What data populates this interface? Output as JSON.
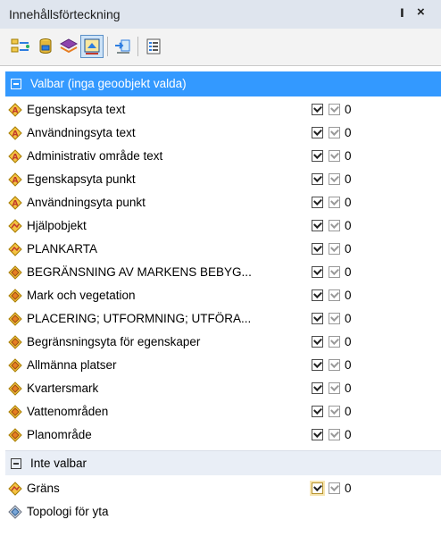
{
  "window": {
    "title": "Innehållsförteckning",
    "pin_glyph": "ⵏ",
    "close_glyph": "×"
  },
  "toolbar": {
    "buttons": [
      {
        "name": "list-by-drawing-order-icon"
      },
      {
        "name": "list-by-source-icon"
      },
      {
        "name": "list-by-visibility-icon"
      },
      {
        "name": "list-by-selection-icon",
        "active": true
      },
      {
        "name": "options-icon"
      },
      {
        "name": "list-options-icon"
      }
    ]
  },
  "groups": [
    {
      "label": "Valbar (inga geoobjekt valda)",
      "selected": true,
      "items": [
        {
          "label": "Egenskapsyta text",
          "icon": "annotation-icon",
          "count": "0"
        },
        {
          "label": "Användningsyta text",
          "icon": "annotation-icon",
          "count": "0"
        },
        {
          "label": "Administrativ område text",
          "icon": "annotation-icon",
          "count": "0"
        },
        {
          "label": "Egenskapsyta punkt",
          "icon": "annotation-icon",
          "count": "0"
        },
        {
          "label": "Användningsyta punkt",
          "icon": "annotation-icon",
          "count": "0"
        },
        {
          "label": "Hjälpobjekt",
          "icon": "line-layer-icon",
          "count": "0"
        },
        {
          "label": "PLANKARTA",
          "icon": "line-layer-icon",
          "count": "0"
        },
        {
          "label": "BEGRÄNSNING AV MARKENS BEBYG...",
          "icon": "polygon-layer-icon",
          "count": "0"
        },
        {
          "label": "Mark och vegetation",
          "icon": "polygon-layer-icon",
          "count": "0"
        },
        {
          "label": "PLACERING; UTFORMNING; UTFÖRA...",
          "icon": "polygon-layer-icon",
          "count": "0"
        },
        {
          "label": "Begränsningsyta för egenskaper",
          "icon": "polygon-layer-icon",
          "count": "0"
        },
        {
          "label": "Allmänna platser",
          "icon": "polygon-layer-icon",
          "count": "0"
        },
        {
          "label": "Kvartersmark",
          "icon": "polygon-layer-icon",
          "count": "0"
        },
        {
          "label": "Vattenområden",
          "icon": "polygon-layer-icon",
          "count": "0"
        },
        {
          "label": "Planområde",
          "icon": "polygon-layer-icon",
          "count": "0"
        }
      ]
    },
    {
      "label": "Inte valbar",
      "selected": false,
      "items": [
        {
          "label": "Gräns",
          "icon": "line-layer-icon",
          "count": "0",
          "boxed": true
        },
        {
          "label": "Topologi för yta",
          "icon": "topology-icon",
          "count": ""
        }
      ]
    }
  ],
  "colors": {
    "selection": "#3399ff",
    "titlebar": "#dfe5ee",
    "annotation_icon": "#c0392b",
    "polygon_icon": "#e67e22"
  }
}
